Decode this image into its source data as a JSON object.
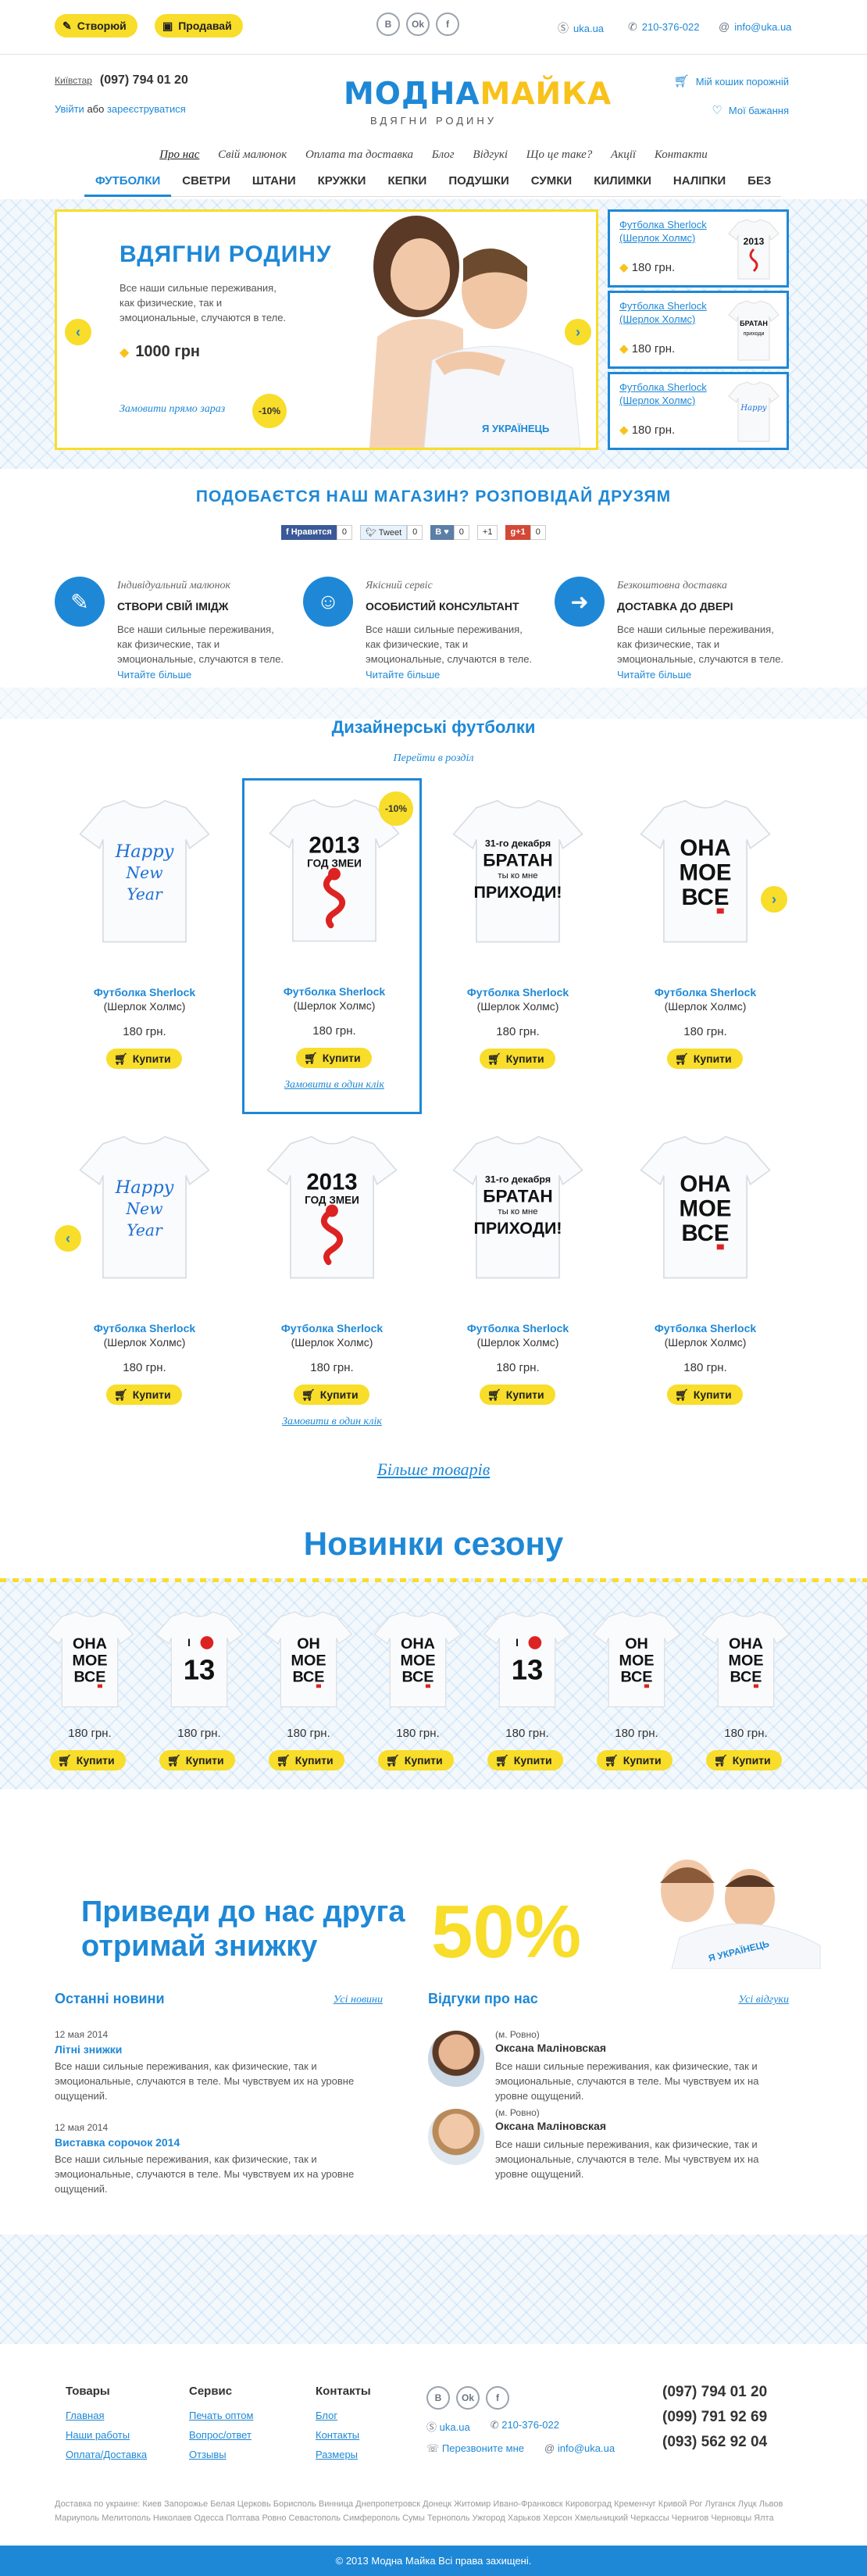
{
  "topbar": {
    "create_label": "Створюй",
    "sell_label": "Продавай",
    "socials": [
      "В",
      "Ok",
      "f"
    ],
    "skype": "uka.ua",
    "phone": "210-376-022",
    "email": "info@uka.ua"
  },
  "header": {
    "operator": "Київстар",
    "phone": "(097) 794 01 20",
    "login": "Увійти",
    "or": "або",
    "register": "зареєструватися",
    "logo_blue": "МОДНА",
    "logo_yellow": "МАЙКА",
    "logo_sub": "ВДЯГНИ РОДИНУ",
    "compare": "Мій кошик порожній",
    "wishlist": "Мої бажання"
  },
  "subnav": [
    "Про нас",
    "Свій малюнок",
    "Оплата та доставка",
    "Блог",
    "Відгукі",
    "Що це таке?",
    "Акції",
    "Контакти"
  ],
  "mainnav": [
    "ФУТБОЛКИ",
    "СВЕТРИ",
    "ШТАНИ",
    "КРУЖКИ",
    "КЕПКИ",
    "ПОДУШКИ",
    "СУМКИ",
    "КИЛИМКИ",
    "НАЛІПКИ",
    "БЕЗ МАЛЮНКУ"
  ],
  "hero": {
    "title": "ВДЯГНИ РОДИНУ",
    "text": "Все наши сильные переживания, как физические, так и эмоциональные, случаются в теле.",
    "price": "1000 грн",
    "order": "Замовити прямо зараз",
    "discount": "-10%",
    "shirt_text": "Я УКРАЇНЕЦЬ"
  },
  "side_cards": [
    {
      "title": "Футболка Sherlock (Шерлок Холмс)",
      "price": "180 грн."
    },
    {
      "title": "Футболка Sherlock (Шерлок Холмс)",
      "price": "180 грн."
    },
    {
      "title": "Футболка Sherlock (Шерлок Холмс)",
      "price": "180 грн."
    }
  ],
  "share": {
    "title": "ПОДОБАЄТСЯ НАШ МАГАЗИН? РОЗПОВІДАЙ ДРУЗЯМ",
    "fb": "Нравится",
    "fb_count": "0",
    "tw": "Tweet",
    "tw_count": "0",
    "vk_count": "0",
    "gp": "+1",
    "gp_count": "0"
  },
  "features": [
    {
      "cat": "Індивідуальний малюнок",
      "title": "СТВОРИ СВІЙ ІМІДЖ",
      "text": "Все наши сильные переживания, как физические, так и эмоциональные, случаются в теле.",
      "link": "Читайте більше"
    },
    {
      "cat": "Якісний сервіс",
      "title": "ОСОБИСТИЙ КОНСУЛЬТАНТ",
      "text": "Все наши сильные переживания, как физические, так и эмоциональные, случаются в теле.",
      "link": "Читайте більше"
    },
    {
      "cat": "Безкоштовна доставка",
      "title": "ДОСТАВКА ДО ДВЕРІ",
      "text": "Все наши сильные переживания, как физические, так и эмоциональные, случаются в теле.",
      "link": "Читайте більше"
    }
  ],
  "designer": {
    "title": "Дизайнерські футболки",
    "link": "Перейти в розділ",
    "discount": "-10%",
    "quick": "Замовити в один клік",
    "more": "Більше товарів",
    "products": [
      {
        "name": "Футболка Sherlock",
        "sub": "(Шерлок Холмс)",
        "price": "180 грн.",
        "buy": "Купити",
        "art": "Happy New Year"
      },
      {
        "name": "Футболка Sherlock",
        "sub": "(Шерлок Холмс)",
        "price": "180 грн.",
        "buy": "Купити",
        "art": "2013 ГОД ЗМЕИ"
      },
      {
        "name": "Футболка Sherlock",
        "sub": "(Шерлок Холмс)",
        "price": "180 грн.",
        "buy": "Купити",
        "art": "31-го декабря БРАТАН ты ко мне ПРИХОДИ!"
      },
      {
        "name": "Футболка Sherlock",
        "sub": "(Шерлок Холмс)",
        "price": "180 грн.",
        "buy": "Купити",
        "art": "ОНА МОЕ ВСЕ"
      },
      {
        "name": "Футболка Sherlock",
        "sub": "(Шерлок Холмс)",
        "price": "180 грн.",
        "buy": "Купити",
        "art": "Happy New Year"
      },
      {
        "name": "Футболка Sherlock",
        "sub": "(Шерлок Холмс)",
        "price": "180 грн.",
        "buy": "Купити",
        "art": "2013 ГОД ЗМЕИ"
      },
      {
        "name": "Футболка Sherlock",
        "sub": "(Шерлок Холмс)",
        "price": "180 грн.",
        "buy": "Купити",
        "art": "31-го декабря БРАТАН ты ко мне ПРИХОДИ!"
      },
      {
        "name": "Футболка Sherlock",
        "sub": "(Шерлок Холмс)",
        "price": "180 грн.",
        "buy": "Купити",
        "art": "ОНА МОЕ ВСЕ"
      }
    ]
  },
  "new_items": {
    "title": "Новинки сезону",
    "items": [
      {
        "art": "ОНА МОЕ ВСЕ",
        "price": "180 грн.",
        "buy": "Купити"
      },
      {
        "art": "I ♥ 13",
        "price": "180 грн.",
        "buy": "Купити"
      },
      {
        "art": "ОН МОЕ ВСЕ",
        "price": "180 грн.",
        "buy": "Купити"
      },
      {
        "art": "ОНА МОЕ ВСЕ",
        "price": "180 грн.",
        "buy": "Купити"
      },
      {
        "art": "I ♥ 13",
        "price": "180 грн.",
        "buy": "Купити"
      },
      {
        "art": "ОН МОЕ ВСЕ",
        "price": "180 грн.",
        "buy": "Купити"
      },
      {
        "art": "ОНА МОЕ ВСЕ",
        "price": "180 грн.",
        "buy": "Купити"
      }
    ]
  },
  "promo": {
    "line1": "Приведи до нас друга",
    "line2": "отримай знижку",
    "percent": "50%",
    "shirt_text": "Я УКРАЇНЕЦЬ"
  },
  "news": {
    "title": "Останні новини",
    "all": "Усі новини",
    "items": [
      {
        "date": "12 мая 2014",
        "title": "Літні знижки",
        "text": "Все наши сильные переживания, как физические, так и эмоциональные, случаются в теле. Мы чувствуем их на уровне ощущений."
      },
      {
        "date": "12 мая 2014",
        "title": "Виставка сорочок 2014",
        "text": "Все наши сильные переживания, как физические, так и эмоциональные, случаются в теле. Мы чувствуем их на уровне ощущений."
      }
    ]
  },
  "reviews": {
    "title": "Відгуки про нас",
    "all": "Усі відгуки",
    "items": [
      {
        "city": "(м. Ровно)",
        "name": "Оксана Маліновская",
        "text": "Все наши сильные переживания, как физические, так и эмоциональные, случаются в теле. Мы чувствуем их на уровне ощущений."
      },
      {
        "city": "(м. Ровно)",
        "name": "Оксана Маліновская",
        "text": "Все наши сильные переживания, как физические, так и эмоциональные, случаются в теле. Мы чувствуем их на уровне ощущений."
      }
    ]
  },
  "footer": {
    "col1": {
      "title": "Товары",
      "links": [
        "Главная",
        "Наши работы",
        "Оплата/Доставка"
      ]
    },
    "col2": {
      "title": "Сервис",
      "links": [
        "Печать оптом",
        "Вопрос/ответ",
        "Отзывы"
      ]
    },
    "col3": {
      "title": "Контакты",
      "links": [
        "Блог",
        "Контакты",
        "Размеры"
      ]
    },
    "socials": [
      "В",
      "Ok",
      "f"
    ],
    "skype": "uka.ua",
    "phone": "210-376-022",
    "callback": "Перезвоните мне",
    "email": "info@uka.ua",
    "phones": [
      "(097) 794 01 20",
      "(099) 791 92 69",
      "(093) 562 92 04"
    ],
    "cities": "Доставка по украине: Киев Запорожье Белая Церковь Борисполь Винница Днепропетровск Донецк Житомир Ивано-Франковск Кировоград Кременчуг Кривой Рог Луганск Луцк Львов Мариуполь Мелитополь Николаев Одесса Полтава Ровно Севастополь Симферополь Сумы Тернополь Ужгород Харьков Херсон Хмельницкий Черкассы Чернигов Черновцы Ялта",
    "copyright": "© 2013 Модна Майка Всі права захищені."
  }
}
